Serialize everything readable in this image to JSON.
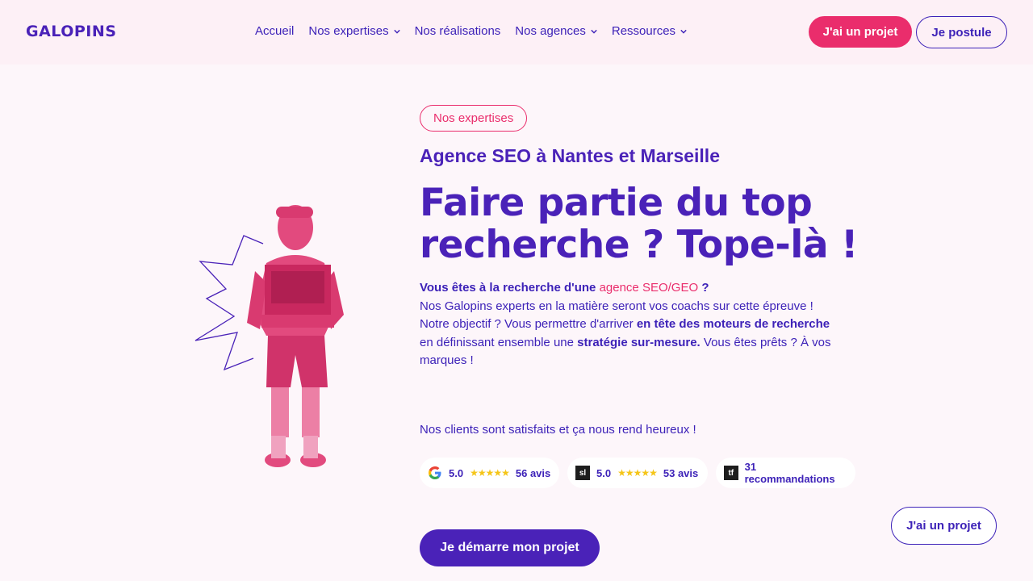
{
  "header": {
    "logo": "GALOPINS",
    "nav": [
      {
        "label": "Accueil",
        "has_dropdown": false
      },
      {
        "label": "Nos expertises",
        "has_dropdown": true
      },
      {
        "label": "Nos réalisations",
        "has_dropdown": false
      },
      {
        "label": "Nos agences",
        "has_dropdown": true
      },
      {
        "label": "Ressources",
        "has_dropdown": true
      }
    ],
    "project_button": "J'ai un projet",
    "apply_button": "Je postule"
  },
  "hero": {
    "badge": "Nos expertises",
    "subtitle": "Agence SEO à Nantes et Marseille",
    "headline_line1": "Faire partie du top",
    "headline_line2": "recherche ? Tope-là !",
    "para": {
      "intro_bold": "Vous êtes à la recherche d'une",
      "intro_link": "agence SEO/GEO",
      "intro_end": "?",
      "line2": "Nos Galopins experts en la matière seront vos coachs sur cette épreuve !",
      "line3_start": "Notre objectif ? Vous permettre d'arriver",
      "line3_bold": "en tête des moteurs de recherche",
      "line3_mid": "en définissant ensemble une",
      "line3_bold2": "stratégie sur-mesure.",
      "line3_end": "Vous êtes prêts ? À vos marques !"
    },
    "satisfied": "Nos clients sont satisfaits et ça nous rend heureux !",
    "reviews": [
      {
        "source_icon": "google-icon",
        "rating": "5.0",
        "stars": "★★★★★",
        "count": "56 avis"
      },
      {
        "source_icon": "sortlist-icon",
        "icon_text": "sl",
        "rating": "5.0",
        "stars": "★★★★★",
        "count": "53 avis"
      },
      {
        "source_icon": "techbehemoths-icon",
        "icon_text": "tf",
        "count": "31 recommandations"
      }
    ],
    "cta": "Je démarre mon projet"
  },
  "floating_button": "J'ai un projet",
  "colors": {
    "primary": "#4a22b8",
    "accent": "#ea2d6c",
    "background": "#fdf6fa",
    "header_bg": "#fdf0f6",
    "stars": "#f5c518"
  }
}
